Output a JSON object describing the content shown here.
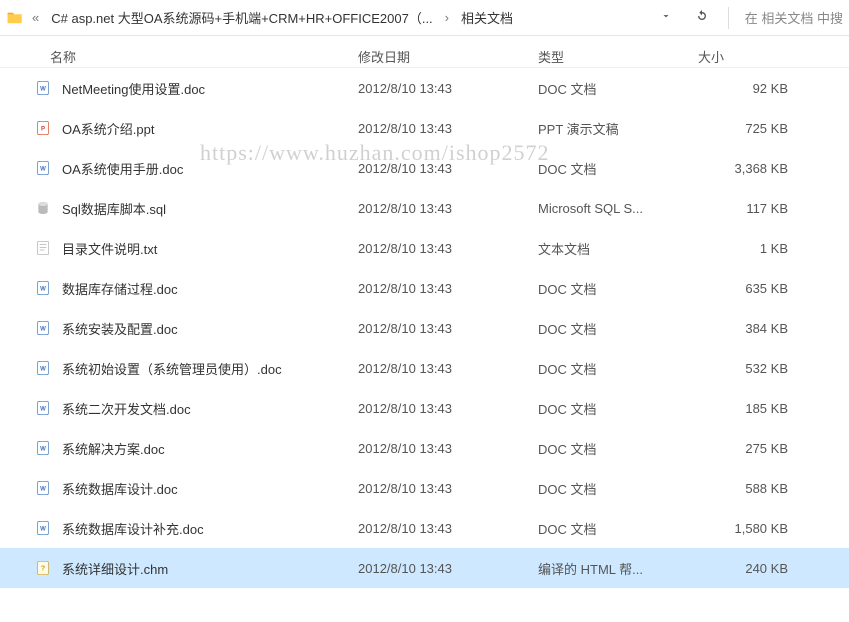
{
  "toolbar": {
    "breadcrumb_sep": "«",
    "path_parent": "C# asp.net 大型OA系统源码+手机端+CRM+HR+OFFICE2007（...",
    "path_sep": "›",
    "path_current": "相关文档",
    "search_hint": "在 相关文档 中搜"
  },
  "headers": {
    "name": "名称",
    "date": "修改日期",
    "type": "类型",
    "size": "大小"
  },
  "files": [
    {
      "icon": "doc",
      "name": "NetMeeting使用设置.doc",
      "date": "2012/8/10 13:43",
      "type": "DOC 文档",
      "size": "92 KB",
      "selected": false
    },
    {
      "icon": "ppt",
      "name": "OA系统介绍.ppt",
      "date": "2012/8/10 13:43",
      "type": "PPT 演示文稿",
      "size": "725 KB",
      "selected": false
    },
    {
      "icon": "doc",
      "name": "OA系统使用手册.doc",
      "date": "2012/8/10 13:43",
      "type": "DOC 文档",
      "size": "3,368 KB",
      "selected": false
    },
    {
      "icon": "sql",
      "name": "Sql数据库脚本.sql",
      "date": "2012/8/10 13:43",
      "type": "Microsoft SQL S...",
      "size": "117 KB",
      "selected": false
    },
    {
      "icon": "txt",
      "name": "目录文件说明.txt",
      "date": "2012/8/10 13:43",
      "type": "文本文档",
      "size": "1 KB",
      "selected": false
    },
    {
      "icon": "doc",
      "name": "数据库存储过程.doc",
      "date": "2012/8/10 13:43",
      "type": "DOC 文档",
      "size": "635 KB",
      "selected": false
    },
    {
      "icon": "doc",
      "name": "系统安装及配置.doc",
      "date": "2012/8/10 13:43",
      "type": "DOC 文档",
      "size": "384 KB",
      "selected": false
    },
    {
      "icon": "doc",
      "name": "系统初始设置（系统管理员使用）.doc",
      "date": "2012/8/10 13:43",
      "type": "DOC 文档",
      "size": "532 KB",
      "selected": false
    },
    {
      "icon": "doc",
      "name": "系统二次开发文档.doc",
      "date": "2012/8/10 13:43",
      "type": "DOC 文档",
      "size": "185 KB",
      "selected": false
    },
    {
      "icon": "doc",
      "name": "系统解决方案.doc",
      "date": "2012/8/10 13:43",
      "type": "DOC 文档",
      "size": "275 KB",
      "selected": false
    },
    {
      "icon": "doc",
      "name": "系统数据库设计.doc",
      "date": "2012/8/10 13:43",
      "type": "DOC 文档",
      "size": "588 KB",
      "selected": false
    },
    {
      "icon": "doc",
      "name": "系统数据库设计补充.doc",
      "date": "2012/8/10 13:43",
      "type": "DOC 文档",
      "size": "1,580 KB",
      "selected": false
    },
    {
      "icon": "chm",
      "name": "系统详细设计.chm",
      "date": "2012/8/10 13:43",
      "type": "编译的 HTML 帮...",
      "size": "240 KB",
      "selected": true
    }
  ],
  "watermark": "https://www.huzhan.com/ishop2572"
}
